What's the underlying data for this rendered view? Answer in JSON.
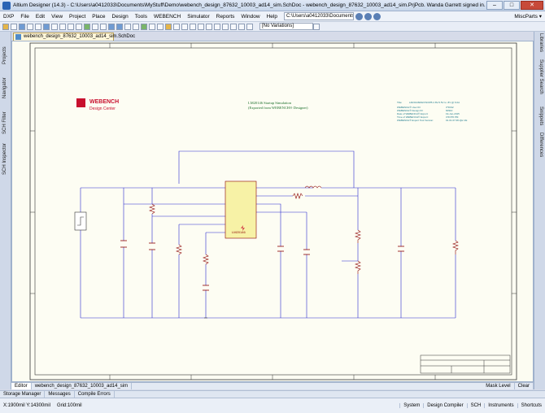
{
  "window": {
    "title": "Altium Designer (14.3) - C:\\Users\\a0412033\\Documents\\MyStuff\\Demo\\webench_design_87632_10003_ad14_sim.SchDoc - webench_design_87632_10003_ad14_sim.PrjPcb. Wanda Garrett signed in.",
    "minimize": "–",
    "maximize": "□",
    "close": "✕"
  },
  "menu": {
    "items": [
      "DXP",
      "File",
      "Edit",
      "View",
      "Project",
      "Place",
      "Design",
      "Tools",
      "WEBENCH",
      "Simulator",
      "Reports",
      "Window",
      "Help"
    ],
    "path": "C:\\Users\\a0412033\\Documents\\My",
    "misc": "MiscParts ▾"
  },
  "toolbar": {
    "variations": "[No Variations]"
  },
  "left_panel": [
    "Projects",
    "Navigator",
    "SCH Filter",
    "SCH Inspector"
  ],
  "right_panel": [
    "Libraries",
    "Supplier Search",
    "Snippets",
    "Differences"
  ],
  "document_tab": "webench_design_87632_10003_ad14_sim.SchDoc",
  "schematic": {
    "logo_text": "WEBENCH",
    "logo_sub": "Design Center",
    "heading_1": "LM20146 Startup Simulation",
    "heading_2": "(Exported from WEBENCH® Designer)",
    "ic_label": "LM20146",
    "info_title": "Title:",
    "info_title_value": "LM20146MHX/NOPB 2.8V-5.5V to .8V @ 6.0A",
    "info_rows": [
      {
        "k": "WEBENCH® User ID:",
        "v": "3*F032"
      },
      {
        "k": "WEBENCH® Design ID:",
        "v": "60910"
      },
      {
        "k": "Date of WEBENCH® Export:",
        "v": "19-Jun-2015"
      },
      {
        "k": "Time of WEBENCH® Export:",
        "v": "3:53:55 PM"
      },
      {
        "k": "WEBENCH® Export Tool Version:",
        "v": "01.01.07.08-QH-VE"
      }
    ]
  },
  "bottom_tabs": {
    "editor": "Editor",
    "doc": "webench_design_87632_10003_ad14_sim",
    "mask_level": "Mask Level",
    "clear": "Clear"
  },
  "panel_tabs": [
    "Storage Manager",
    "Messages",
    "Compile Errors"
  ],
  "status": {
    "coords": "X:1900mil Y:14300mil",
    "grid": "Grid:100mil",
    "right": [
      "System",
      "Design Compiler",
      "SCH",
      "Instruments",
      "Shortcuts"
    ]
  }
}
